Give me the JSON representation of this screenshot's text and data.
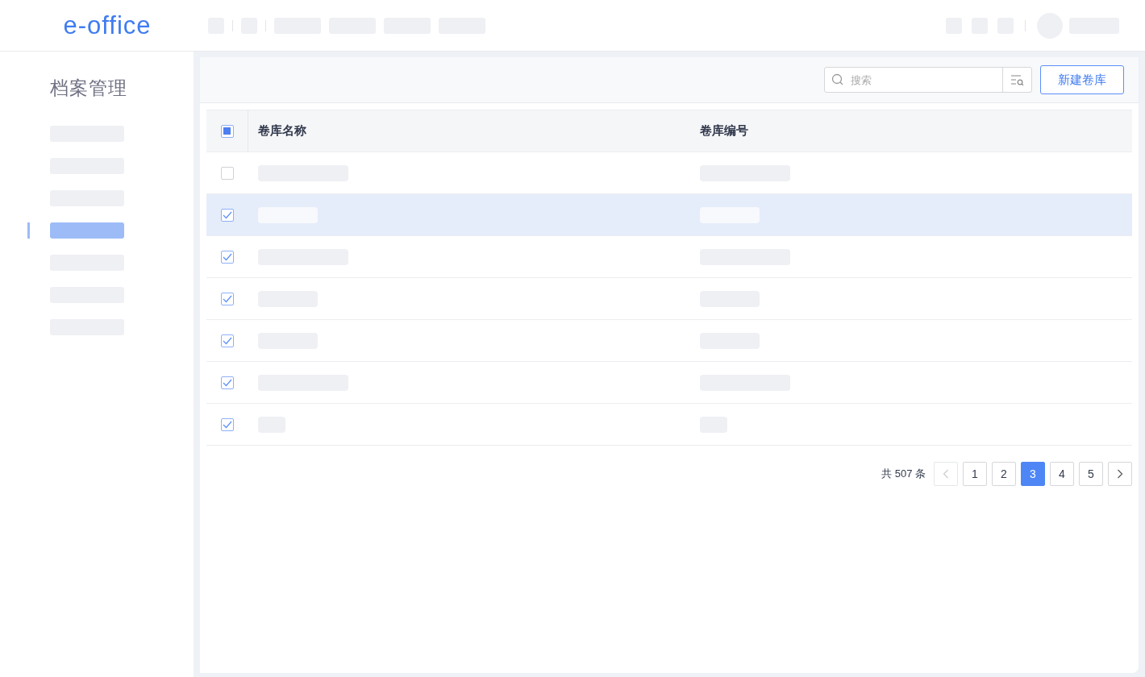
{
  "header": {
    "logo": "e-office"
  },
  "sidebar": {
    "title": "档案管理",
    "items": [
      {
        "selected": false
      },
      {
        "selected": false
      },
      {
        "selected": false
      },
      {
        "selected": true
      },
      {
        "selected": false
      },
      {
        "selected": false
      },
      {
        "selected": false
      }
    ]
  },
  "toolbar": {
    "search": {
      "placeholder": "搜索"
    },
    "new_button": "新建卷库"
  },
  "table": {
    "select_all": {
      "indeterminate": true
    },
    "columns": [
      "卷库名称",
      "卷库编号"
    ],
    "rows": [
      {
        "checked": false,
        "selected": false
      },
      {
        "checked": true,
        "selected": true
      },
      {
        "checked": true,
        "selected": false
      },
      {
        "checked": true,
        "selected": false
      },
      {
        "checked": true,
        "selected": false
      },
      {
        "checked": true,
        "selected": false
      },
      {
        "checked": true,
        "selected": false
      }
    ]
  },
  "pagination": {
    "total": "共 507 条",
    "prev": {
      "disabled": true
    },
    "pages": [
      {
        "label": "1",
        "selected": false
      },
      {
        "label": "2",
        "selected": false
      },
      {
        "label": "3",
        "selected": true
      },
      {
        "label": "4",
        "selected": false
      },
      {
        "label": "5",
        "selected": false
      }
    ],
    "next": {
      "disabled": false
    }
  }
}
